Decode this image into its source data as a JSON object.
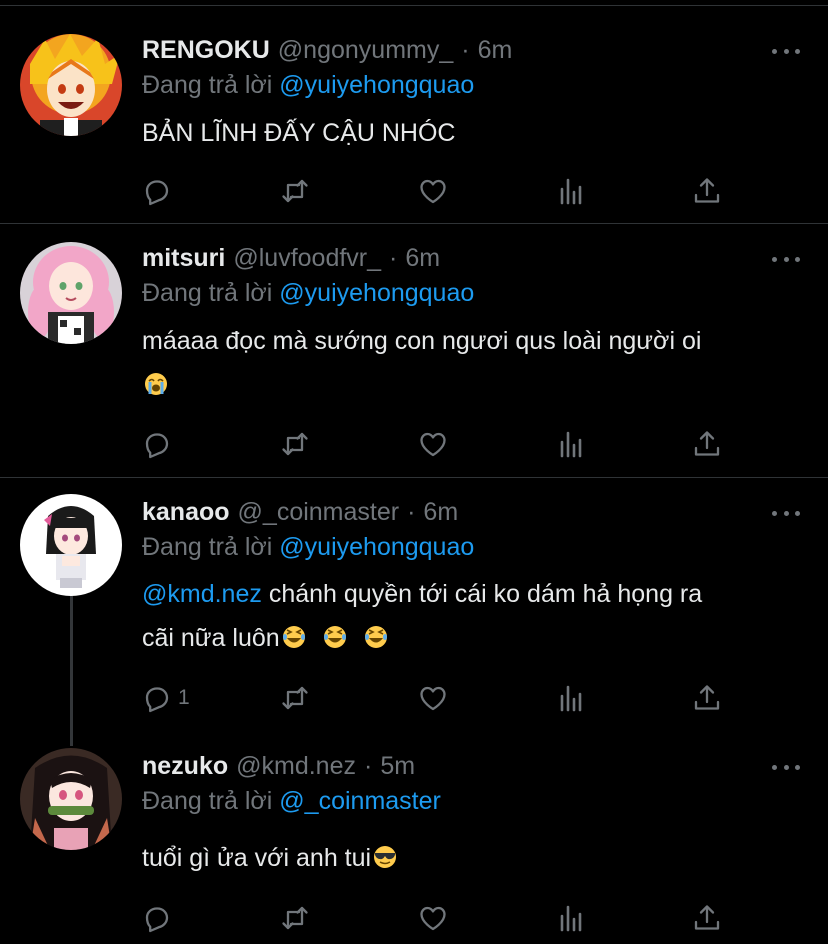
{
  "colors": {
    "background": "#000000",
    "text": "#e7e9ea",
    "muted": "#71767b",
    "link": "#1d9bf0",
    "divider": "#2f3336"
  },
  "icons": {
    "reply": "reply-icon",
    "retweet": "retweet-icon",
    "like": "like-icon",
    "analytics": "analytics-icon",
    "share": "share-icon",
    "more": "more-icon"
  },
  "replying_prefix": "Đang trả lời",
  "tweets": [
    {
      "name": "RENGOKU",
      "handle": "@ngonyummy_",
      "time": "6m",
      "reply_to": "@yuiyehongquao",
      "text_line1": "BẢN LĨNH ĐẤY CẬU NHÓC",
      "reply_count": ""
    },
    {
      "name": "mitsuri",
      "handle": "@luvfoodfvr_",
      "time": "6m",
      "reply_to": "@yuiyehongquao",
      "text_line1": "máaaa đọc mà sướng con ngươi qus loài người oi",
      "emoji": "crying-emoji",
      "reply_count": ""
    },
    {
      "name": "kanaoo",
      "handle": "@_coinmaster",
      "time": "6m",
      "reply_to": "@yuiyehongquao",
      "mention": "@kmd.nez",
      "text_line1": " chánh quyền tới cái ko dám hả họng ra",
      "text_line2": "cãi nữa luôn",
      "emoji": "laughing-emoji",
      "reply_count": "1"
    },
    {
      "name": "nezuko",
      "handle": "@kmd.nez",
      "time": "5m",
      "reply_to": "@_coinmaster",
      "text_line1": "tuổi gì ửa với anh tui",
      "emoji": "sunglasses-emoji",
      "reply_count": ""
    }
  ]
}
